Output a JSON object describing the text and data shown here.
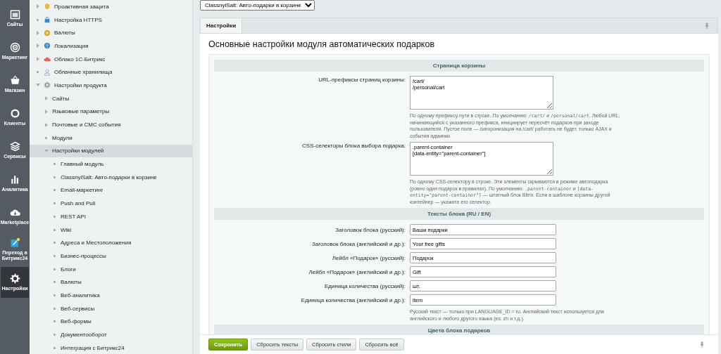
{
  "rail": [
    {
      "label": "Сайты",
      "selected": false
    },
    {
      "label": "Маркетинг",
      "selected": false
    },
    {
      "label": "Магазин",
      "selected": false
    },
    {
      "label": "Клиенты",
      "selected": false
    },
    {
      "label": "Сервисы",
      "selected": false
    },
    {
      "label": "Аналитика",
      "selected": false
    },
    {
      "label": "Marketplace",
      "selected": false
    },
    {
      "label": "Переход в Битрикс24",
      "selected": false
    },
    {
      "label": "Настройки",
      "selected": true
    }
  ],
  "tree": [
    {
      "label": "Проактивная защита",
      "expanded": false,
      "selected": false
    },
    {
      "label": "Настройка HTTPS",
      "selected": false
    },
    {
      "label": "Валюты",
      "expanded": false,
      "selected": false
    },
    {
      "label": "Локализация",
      "expanded": false,
      "selected": false
    },
    {
      "label": "Облако 1С-Битрикс",
      "expanded": false,
      "selected": false
    },
    {
      "label": "Облачные хранилища",
      "selected": false
    },
    {
      "label": "Настройки продукта",
      "expanded": true,
      "selected": false,
      "children": [
        {
          "label": "Сайты",
          "expanded": false,
          "selected": false
        },
        {
          "label": "Языковые параметры",
          "expanded": false,
          "selected": false
        },
        {
          "label": "Почтовые и СМС события",
          "expanded": false,
          "selected": false
        },
        {
          "label": "Модули",
          "selected": false
        },
        {
          "label": "Настройки модулей",
          "expanded": true,
          "selected": true,
          "children": [
            {
              "label": "Главный модуль",
              "selected": false
            },
            {
              "label": "ClassnyiSalt: Авто-подарки в корзине",
              "selected": false
            },
            {
              "label": "Email-маркетинг",
              "selected": false
            },
            {
              "label": "Push and Pull",
              "selected": false
            },
            {
              "label": "REST API",
              "selected": false
            },
            {
              "label": "Wiki",
              "selected": false
            },
            {
              "label": "Адреса и Местоположения",
              "selected": false
            },
            {
              "label": "Бизнес-процессы",
              "selected": false
            },
            {
              "label": "Блоги",
              "selected": false
            },
            {
              "label": "Валюты",
              "selected": false
            },
            {
              "label": "Веб-аналитика",
              "selected": false
            },
            {
              "label": "Веб-сервисы",
              "selected": false
            },
            {
              "label": "Веб-формы",
              "selected": false
            },
            {
              "label": "Документооборот",
              "selected": false
            },
            {
              "label": "Интеграция с Битрикс24",
              "selected": false
            }
          ]
        }
      ]
    }
  ],
  "module_select": {
    "value": "ClassnyiSalt: Авто-подарки в корзине"
  },
  "tabs": [
    {
      "label": "Настройки",
      "selected": true
    }
  ],
  "page_title": "Основные настройки модуля автоматических подарков",
  "sections": [
    {
      "title": "Страница корзины",
      "rows": [
        {
          "kind": "textarea",
          "label": "URL-префиксы страниц корзины:",
          "value": "/cart/\n/personal/cart",
          "hint": [
            {
              "text": "По одному префиксу пути в строке. По умолчанию: ",
              "code": false
            },
            {
              "text": "/cart/",
              "code": true
            },
            {
              "text": " и ",
              "code": false
            },
            {
              "text": "/personal/cart",
              "code": true
            },
            {
              "text": ". Любой URL, начинающийся с указанного префикса, инициирует пересчёт подарков при заходе пользователя. Пустое поле — синхронизация на /cart/ работать не будет, только AJAX и события админки.",
              "code": false
            }
          ]
        },
        {
          "kind": "textarea",
          "label": "CSS-селекторы блока выбора подарка:",
          "value": ".parent-container\n[data-entity=\"parent-container\"]",
          "hint": [
            {
              "text": "По одному CSS-селектору в строке. Эти элементы скрываются в режиме автоподарка (ровно один подарок в правилах). По умолчанию: ",
              "code": false
            },
            {
              "text": ".parent-container",
              "code": true
            },
            {
              "text": " и ",
              "code": false
            },
            {
              "text": "[data-entity=\"parent-container\"]",
              "code": true
            },
            {
              "text": " — штатный блок Bitrix. Если в шаблоне корзины другой контейнер — укажите его селектор.",
              "code": false
            }
          ]
        }
      ]
    },
    {
      "title": "Тексты блока (RU / EN)",
      "rows": [
        {
          "kind": "input",
          "label": "Заголовок блока (русский):",
          "value": "Ваши подарки"
        },
        {
          "kind": "input",
          "label": "Заголовок блока (английский и др.):",
          "value": "Your free gifts"
        },
        {
          "kind": "input",
          "label": "Лейбл «Подарок» (русский):",
          "value": "Подарок"
        },
        {
          "kind": "input",
          "label": "Лейбл «Подарок» (английский и др.):",
          "value": "Gift"
        },
        {
          "kind": "input",
          "label": "Единица количества (русский):",
          "value": "шт."
        },
        {
          "kind": "input",
          "label": "Единица количества (английский и др.):",
          "value": "item",
          "hint": [
            {
              "text": "Русский текст — только при LANGUAGE_ID = ru. Английский текст используется для английского и любого другого языка (es, zh и т.д.).",
              "code": false
            }
          ]
        }
      ]
    },
    {
      "title": "Цвета блока подарков"
    }
  ],
  "buttons": [
    {
      "label": "Сохранить",
      "kind": "primary"
    },
    {
      "label": "Сбросить тексты",
      "kind": "secondary"
    },
    {
      "label": "Сбросить стили",
      "kind": "secondary"
    },
    {
      "label": "Сбросить всё",
      "kind": "secondary"
    }
  ]
}
